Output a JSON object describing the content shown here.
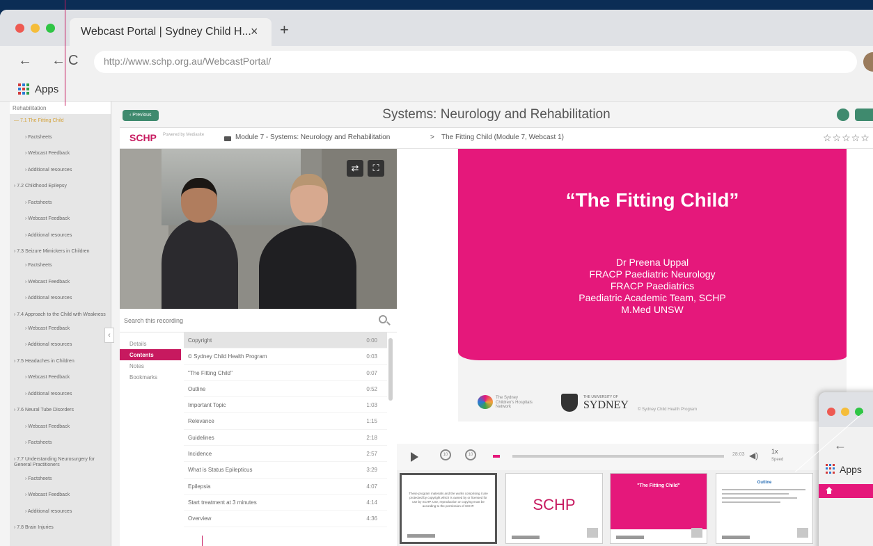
{
  "browser": {
    "tab_title": "Webcast Portal | Sydney Child H...",
    "tab_close": "×",
    "new_tab": "+",
    "url": "http://www.schp.org.au/WebcastPortal/",
    "apps_label": "Apps",
    "dot_colors": [
      "#ee5a52",
      "#f5bd3a",
      "#2fc545"
    ]
  },
  "sidebar": {
    "current": "Rehabilitation",
    "items": [
      {
        "label": "7.1 The Fitting Child",
        "sub": false,
        "active": true
      },
      {
        "label": "Factsheets",
        "sub": true
      },
      {
        "label": "Webcast Feedback",
        "sub": true
      },
      {
        "label": "Additional resources",
        "sub": true
      },
      {
        "label": "7.2 Childhood Epilepsy",
        "sub": false
      },
      {
        "label": "Factsheets",
        "sub": true
      },
      {
        "label": "Webcast Feedback",
        "sub": true
      },
      {
        "label": "Additional resources",
        "sub": true
      },
      {
        "label": "7.3 Seizure Mimickers in Children",
        "sub": false
      },
      {
        "label": "Factsheets",
        "sub": true
      },
      {
        "label": "Webcast Feedback",
        "sub": true
      },
      {
        "label": "Additional resources",
        "sub": true
      },
      {
        "label": "7.4 Approach to the Child with Weakness",
        "sub": false
      },
      {
        "label": "Webcast Feedback",
        "sub": true
      },
      {
        "label": "Additional resources",
        "sub": true
      },
      {
        "label": "7.5 Headaches in Children",
        "sub": false
      },
      {
        "label": "Webcast Feedback",
        "sub": true
      },
      {
        "label": "Additional resources",
        "sub": true
      },
      {
        "label": "7.6 Neural Tube Disorders",
        "sub": false
      },
      {
        "label": "Webcast Feedback",
        "sub": true
      },
      {
        "label": "Factsheets",
        "sub": true
      },
      {
        "label": "7.7 Understanding Neurosurgery for General Practitioners",
        "sub": false
      },
      {
        "label": "Factsheets",
        "sub": true
      },
      {
        "label": "Webcast Feedback",
        "sub": true
      },
      {
        "label": "Additional resources",
        "sub": true
      },
      {
        "label": "7.8 Brain Injuries",
        "sub": false
      }
    ],
    "collapse_icon": "‹"
  },
  "main": {
    "previous_label": "‹ Previous",
    "page_title": "Systems: Neurology and Rehabilitation",
    "logo": "SCHP",
    "powered_by": "Powered by Mediasite",
    "breadcrumb_module": "Module 7 - Systems: Neurology and Rehabilitation",
    "breadcrumb_sep": ">",
    "breadcrumb_webcast": "The Fitting Child (Module 7, Webcast 1)",
    "stars": "☆☆☆☆☆"
  },
  "player": {
    "search_placeholder": "Search this recording",
    "tabs": [
      "Details",
      "Contents",
      "Notes",
      "Bookmarks"
    ],
    "active_tab": 1,
    "contents": [
      {
        "title": "Copyright",
        "time": "0:00"
      },
      {
        "title": "© Sydney Child Health Program",
        "time": "0:03"
      },
      {
        "title": "\"The Fitting Child\"",
        "time": "0:07"
      },
      {
        "title": "Outline",
        "time": "0:52"
      },
      {
        "title": "Important Topic",
        "time": "1:03"
      },
      {
        "title": "Relevance",
        "time": "1:15"
      },
      {
        "title": "Guidelines",
        "time": "2:18"
      },
      {
        "title": "Incidence",
        "time": "2:57"
      },
      {
        "title": "What is Status Epilepticus",
        "time": "3:29"
      },
      {
        "title": "Epilepsia",
        "time": "4:07"
      },
      {
        "title": "Start treatment at 3 minutes",
        "time": "4:14"
      },
      {
        "title": "Overview",
        "time": "4:36"
      }
    ],
    "skip_back": "10",
    "skip_forward": "10",
    "progress_fraction": 0.0,
    "duration": "28:03",
    "speed_value": "1x",
    "speed_label": "Speed"
  },
  "slide": {
    "title": "“The Fitting Child”",
    "lines": [
      "Dr Preena Uppal",
      "FRACP Paediatric Neurology",
      "FRACP Paediatrics",
      "Paediatric Academic Team, SCHP",
      "M.Med UNSW"
    ],
    "partner_name": "The Sydney Children's Hospitals Network",
    "university_small": "THE UNIVERSITY OF",
    "university_name": "SYDNEY",
    "footer": "© Sydney Child Health Program"
  },
  "thumbnails": [
    {
      "kind": "text",
      "text": "These program materials and the works comprising it are protected by copyright which is owned by or licensed for use by SCHP. Use, reproduction or copying must be according to the permission of SCHP."
    },
    {
      "kind": "logo",
      "text": "SCHP"
    },
    {
      "kind": "pink",
      "text": "\"The Fitting Child\""
    },
    {
      "kind": "outline",
      "text": "Outline"
    }
  ],
  "mini_window": {
    "apps_label": "Apps"
  },
  "colors": {
    "brand_pink": "#e5187b",
    "accent_green": "#3f8a6e",
    "background_navy": "#0b2d55"
  }
}
